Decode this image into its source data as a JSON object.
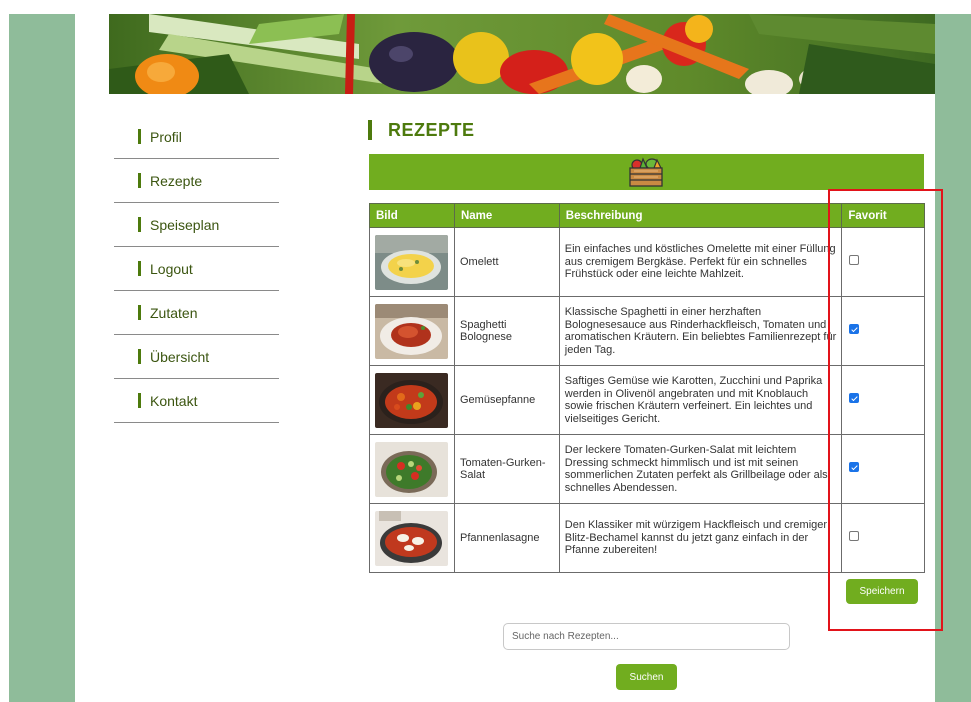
{
  "nav": {
    "items": [
      {
        "label": "Profil"
      },
      {
        "label": "Rezepte"
      },
      {
        "label": "Speiseplan"
      },
      {
        "label": "Logout"
      },
      {
        "label": "Zutaten"
      },
      {
        "label": "Übersicht"
      },
      {
        "label": "Kontakt"
      }
    ]
  },
  "page": {
    "title": "REZEPTE"
  },
  "strip": {
    "icon": "vegetable-crate-icon"
  },
  "table": {
    "headers": {
      "image": "Bild",
      "name": "Name",
      "description": "Beschreibung",
      "favorite": "Favorit"
    },
    "rows": [
      {
        "name": "Omelett",
        "description": "Ein einfaches und köstliches Omelette mit einer Füllung aus cremigem Bergkäse. Perfekt für ein schnelles Frühstück oder eine leichte Mahlzeit.",
        "favorite": false
      },
      {
        "name": "Spaghetti Bolognese",
        "description": "Klassische Spaghetti in einer herzhaften Bolognesesauce aus Rinderhackfleisch, Tomaten und aromatischen Kräutern. Ein beliebtes Familienrezept für jeden Tag.",
        "favorite": true
      },
      {
        "name": "Gemüsepfanne",
        "description": "Saftiges Gemüse wie Karotten, Zucchini und Paprika werden in Olivenöl angebraten und mit Knoblauch sowie frischen Kräutern verfeinert. Ein leichtes und vielseitiges Gericht.",
        "favorite": true
      },
      {
        "name": "Tomaten-Gurken-Salat",
        "description": "Der leckere Tomaten-Gurken-Salat mit leichtem Dressing schmeckt himmlisch und ist mit seinen sommerlichen Zutaten perfekt als Grillbeilage oder als schnelles Abendessen.",
        "favorite": true
      },
      {
        "name": "Pfannenlasagne",
        "description": "Den Klassiker mit würzigem Hackfleisch und cremiger Blitz-Bechamel kannst du jetzt ganz einfach in der Pfanne zubereiten!",
        "favorite": false
      }
    ]
  },
  "actions": {
    "save_label": "Speichern",
    "search_label": "Suchen"
  },
  "search": {
    "placeholder": "Suche nach Rezepten..."
  },
  "colors": {
    "accent": "#71ad1f",
    "side_panel": "#8fbc9a",
    "highlight": "#e2131a",
    "checkbox_on": "#1a73e8"
  }
}
